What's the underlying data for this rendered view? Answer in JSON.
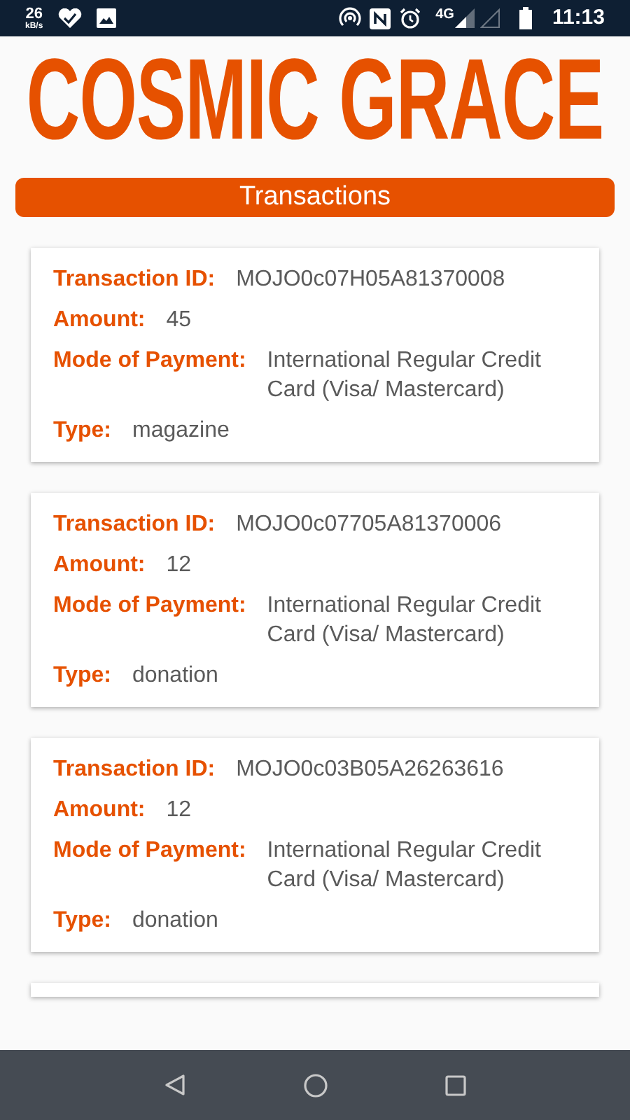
{
  "status_bar": {
    "speed": "26",
    "speed_unit": "kB/s",
    "network": "4G",
    "time": "11:13"
  },
  "logo": "COSMIC GRACE",
  "header": "Transactions",
  "transactions": [
    {
      "fields": [
        {
          "label": "Transaction ID:",
          "value": "MOJO0c07H05A81370008"
        },
        {
          "label": "Amount:",
          "value": "45"
        },
        {
          "label": "Mode of Payment:",
          "value": "International Regular Credit Card (Visa/ Mastercard)"
        },
        {
          "label": "Type:",
          "value": "magazine"
        }
      ]
    },
    {
      "fields": [
        {
          "label": "Transaction ID:",
          "value": "MOJO0c07705A81370006"
        },
        {
          "label": "Amount:",
          "value": "12"
        },
        {
          "label": "Mode of Payment:",
          "value": "International Regular Credit Card (Visa/ Mastercard)"
        },
        {
          "label": "Type:",
          "value": "donation"
        }
      ]
    },
    {
      "fields": [
        {
          "label": "Transaction ID:",
          "value": "MOJO0c03B05A26263616"
        },
        {
          "label": "Amount:",
          "value": "12"
        },
        {
          "label": "Mode of Payment:",
          "value": "International Regular Credit Card (Visa/ Mastercard)"
        },
        {
          "label": "Type:",
          "value": "donation"
        }
      ]
    }
  ]
}
